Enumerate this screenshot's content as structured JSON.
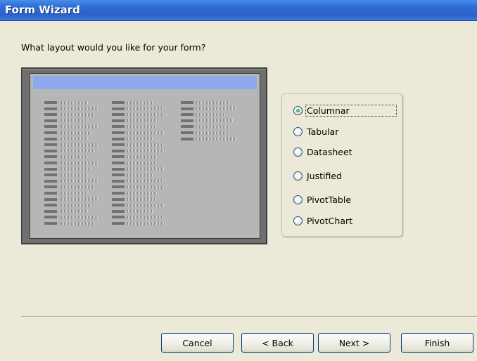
{
  "window": {
    "title": "Form Wizard"
  },
  "prompt": "What layout would you like for your form?",
  "layout_options": [
    {
      "label": "Columnar",
      "checked": true
    },
    {
      "label": "Tabular",
      "checked": false
    },
    {
      "label": "Datasheet",
      "checked": false
    },
    {
      "label": "Justified",
      "checked": false
    },
    {
      "label": "PivotTable",
      "checked": false
    },
    {
      "label": "PivotChart",
      "checked": false
    }
  ],
  "buttons": {
    "cancel": "Cancel",
    "back": "< Back",
    "next": "Next >",
    "finish": "Finish"
  }
}
